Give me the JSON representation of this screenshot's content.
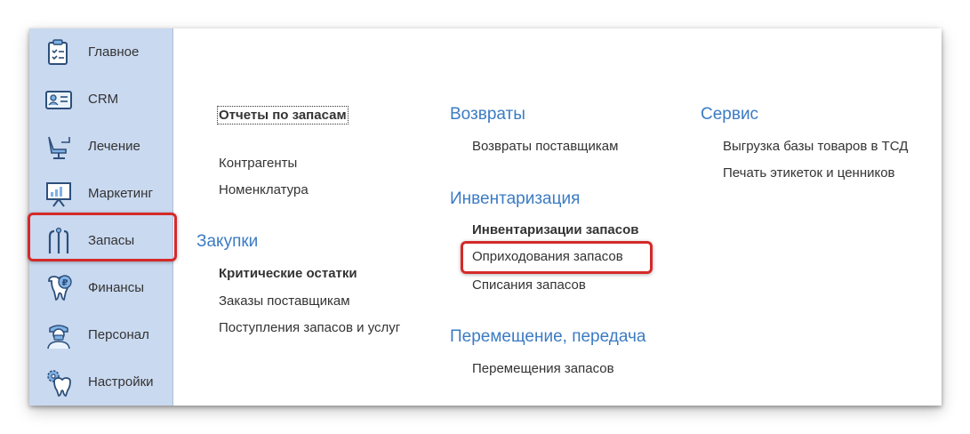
{
  "sidebar": {
    "items": [
      {
        "label": "Главное",
        "icon": "home-tasks-icon"
      },
      {
        "label": "CRM",
        "icon": "crm-card-icon"
      },
      {
        "label": "Лечение",
        "icon": "dental-chair-icon"
      },
      {
        "label": "Маркетинг",
        "icon": "presentation-board-icon"
      },
      {
        "label": "Запасы",
        "icon": "dental-tools-icon",
        "active": true
      },
      {
        "label": "Финансы",
        "icon": "tooth-ruble-icon"
      },
      {
        "label": "Персонал",
        "icon": "doctor-icon"
      },
      {
        "label": "Настройки",
        "icon": "tooth-gear-icon"
      }
    ]
  },
  "content": {
    "col1": {
      "top_links": [
        "Отчеты по запасам",
        "Контрагенты",
        "Номенклатура"
      ],
      "section_title": "Закупки",
      "links": [
        "Критические остатки",
        "Заказы поставщикам",
        "Поступления запасов и услуг"
      ]
    },
    "col2": {
      "sections": [
        {
          "title": "Возвраты",
          "links": [
            "Возвраты поставщикам"
          ]
        },
        {
          "title": "Инвентаризация",
          "links": [
            "Инвентаризации запасов",
            "Оприходования запасов",
            "Списания запасов"
          ]
        },
        {
          "title": "Перемещение, передача",
          "links": [
            "Перемещения запасов"
          ]
        }
      ]
    },
    "col3": {
      "section_title": "Сервис",
      "links": [
        "Выгрузка базы товаров в ТСД",
        "Печать этикеток и ценников"
      ]
    }
  },
  "colors": {
    "sidebar_bg": "#c9d9f0",
    "section_title": "#3b7bc4",
    "highlight": "#d42a2a"
  }
}
